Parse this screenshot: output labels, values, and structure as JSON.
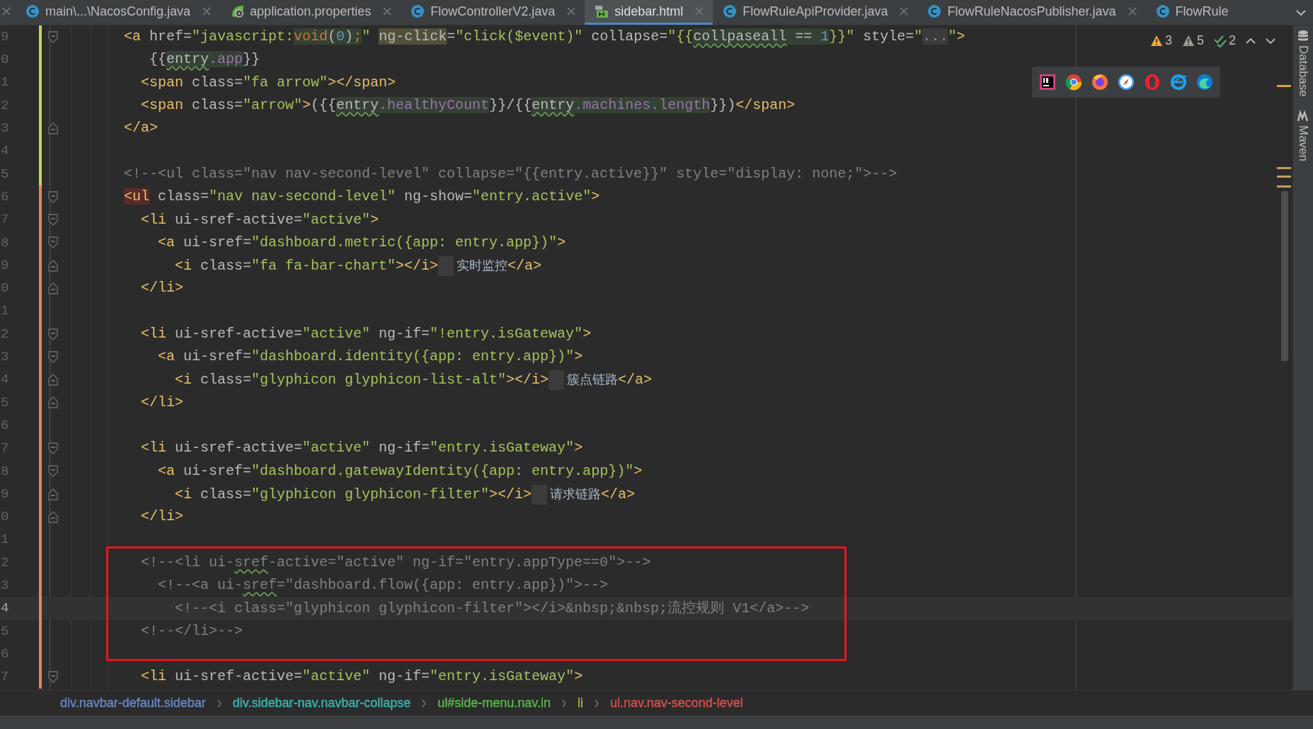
{
  "tabs": [
    {
      "title": "main\\...\\NacosConfig.java",
      "kind": "java",
      "selected": false,
      "closable": true
    },
    {
      "title": "application.properties",
      "kind": "properties",
      "selected": false,
      "closable": true
    },
    {
      "title": "FlowControllerV2.java",
      "kind": "java",
      "selected": false,
      "closable": true
    },
    {
      "title": "sidebar.html",
      "kind": "html",
      "selected": true,
      "closable": true
    },
    {
      "title": "FlowRuleApiProvider.java",
      "kind": "java",
      "selected": false,
      "closable": true
    },
    {
      "title": "FlowRuleNacosPublisher.java",
      "kind": "java",
      "selected": false,
      "closable": true
    },
    {
      "title": "FlowRule",
      "kind": "java",
      "selected": false,
      "closable": false
    }
  ],
  "inspections": [
    {
      "kind": "warning",
      "count": "3"
    },
    {
      "kind": "weak-warning",
      "count": "5"
    },
    {
      "kind": "typo",
      "count": "2"
    }
  ],
  "lines": [
    {
      "number": "9",
      "current": false,
      "color": "#c5d65a",
      "fold_start": true,
      "fold_end": false,
      "tokens": [
        {
          "kind": "tag",
          "text": "<a"
        },
        {
          "kind": "attr",
          "text": " href="
        },
        {
          "kind": "str",
          "text": "\"javascript:"
        },
        {
          "kind": "usage-keyword",
          "text": "void"
        },
        {
          "kind": "usage-text",
          "text": "("
        },
        {
          "kind": "usage-num",
          "text": "0"
        },
        {
          "kind": "usage-text",
          "text": ")"
        },
        {
          "kind": "usage-keyword",
          "text": ";"
        },
        {
          "kind": "str",
          "text": "\" "
        },
        {
          "kind": "match-attr",
          "text": "ng-click"
        },
        {
          "kind": "attr",
          "text": "="
        },
        {
          "kind": "str",
          "text": "\"click($event)\""
        },
        {
          "kind": "attr",
          "text": " collapse="
        },
        {
          "kind": "str",
          "text": "\"{{"
        },
        {
          "kind": "usage-ident",
          "text": "collpaseall"
        },
        {
          "kind": "usage-text",
          "text": " == "
        },
        {
          "kind": "usage-num",
          "text": "1"
        },
        {
          "kind": "str",
          "text": "}}\""
        },
        {
          "kind": "attr",
          "text": " style="
        },
        {
          "kind": "str",
          "text": "\""
        },
        {
          "kind": "folded-text",
          "text": "..."
        },
        {
          "kind": "str",
          "text": "\""
        },
        {
          "kind": "tag",
          "text": ">"
        }
      ]
    },
    {
      "number": "0",
      "current": false,
      "color": "#c5d65a",
      "fold_start": false,
      "fold_end": false,
      "tokens": [
        {
          "kind": "text",
          "text": "   {{"
        },
        {
          "kind": "usage-ident",
          "text": "entry"
        },
        {
          "kind": "usage-field",
          "text": ".app"
        },
        {
          "kind": "text",
          "text": "}}"
        }
      ]
    },
    {
      "number": "1",
      "current": false,
      "color": "#c5d65a",
      "fold_start": false,
      "fold_end": false,
      "tokens": [
        {
          "kind": "tag",
          "text": "  <span"
        },
        {
          "kind": "attr",
          "text": " class="
        },
        {
          "kind": "str",
          "text": "\"fa arrow\""
        },
        {
          "kind": "tag",
          "text": "></span>"
        }
      ]
    },
    {
      "number": "2",
      "current": false,
      "color": "#c5d65a",
      "fold_start": false,
      "fold_end": false,
      "tokens": [
        {
          "kind": "tag",
          "text": "  <span"
        },
        {
          "kind": "attr",
          "text": " class="
        },
        {
          "kind": "str",
          "text": "\"arrow\""
        },
        {
          "kind": "tag",
          "text": ">"
        },
        {
          "kind": "text",
          "text": "({{"
        },
        {
          "kind": "usage-ident",
          "text": "entry"
        },
        {
          "kind": "usage-field",
          "text": ".healthyCount"
        },
        {
          "kind": "text",
          "text": "}}/{{"
        },
        {
          "kind": "usage-ident",
          "text": "entry"
        },
        {
          "kind": "usage-field",
          "text": ".machines.length"
        },
        {
          "kind": "text",
          "text": "}})"
        },
        {
          "kind": "tag",
          "text": "</span>"
        }
      ]
    },
    {
      "number": "3",
      "current": false,
      "color": "#c5d65a",
      "fold_start": false,
      "fold_end": true,
      "tokens": [
        {
          "kind": "tag",
          "text": "</a>"
        }
      ]
    },
    {
      "number": "4",
      "current": false,
      "color": "#c5d65a",
      "fold_start": false,
      "fold_end": false
    },
    {
      "number": "5",
      "current": false,
      "color": "#c5d65a",
      "fold_start": false,
      "fold_end": false,
      "tokens": [
        {
          "kind": "comment",
          "text": "<!--<ul class=\"nav nav-second-level\" collapse=\"{{entry.active}}\" style=\"display: none;\">-->"
        }
      ]
    },
    {
      "number": "6",
      "current": false,
      "color": "#e8806c",
      "fold_start": true,
      "fold_end": false,
      "tokens": [
        {
          "kind": "error-tag",
          "text": "<ul"
        },
        {
          "kind": "attr",
          "text": " class="
        },
        {
          "kind": "str",
          "text": "\"nav nav-second-level\""
        },
        {
          "kind": "attr",
          "text": " ng-show="
        },
        {
          "kind": "str",
          "text": "\"entry.active\""
        },
        {
          "kind": "tag",
          "text": ">"
        }
      ]
    },
    {
      "number": "7",
      "current": false,
      "color": "#e8806c",
      "fold_start": true,
      "fold_end": false,
      "tokens": [
        {
          "kind": "tag",
          "text": "  <li"
        },
        {
          "kind": "attr",
          "text": " ui-sref-active="
        },
        {
          "kind": "str",
          "text": "\"active\""
        },
        {
          "kind": "tag",
          "text": ">"
        }
      ]
    },
    {
      "number": "8",
      "current": false,
      "color": "#e8806c",
      "fold_start": true,
      "fold_end": false,
      "tokens": [
        {
          "kind": "tag",
          "text": "    <a"
        },
        {
          "kind": "attr",
          "text": " ui-sref="
        },
        {
          "kind": "str",
          "text": "\"dashboard.metric({app: entry.app})\""
        },
        {
          "kind": "tag",
          "text": ">"
        }
      ]
    },
    {
      "number": "9",
      "current": false,
      "color": "#e8806c",
      "fold_start": false,
      "fold_end": true,
      "tokens": [
        {
          "kind": "tag",
          "text": "      <i"
        },
        {
          "kind": "attr",
          "text": " class="
        },
        {
          "kind": "str",
          "text": "\"fa fa-bar-chart\""
        },
        {
          "kind": "tag",
          "text": "></i>"
        },
        {
          "kind": "cjk",
          "text": "实时监控"
        },
        {
          "kind": "tag",
          "text": "</a>"
        }
      ]
    },
    {
      "number": "0",
      "current": false,
      "color": "#e8806c",
      "fold_start": false,
      "fold_end": true,
      "tokens": [
        {
          "kind": "tag",
          "text": "  </li>"
        }
      ]
    },
    {
      "number": "1",
      "current": false,
      "color": "#e8806c",
      "fold_start": false,
      "fold_end": false
    },
    {
      "number": "2",
      "current": false,
      "color": "#e8806c",
      "fold_start": true,
      "fold_end": false,
      "tokens": [
        {
          "kind": "tag",
          "text": "  <li"
        },
        {
          "kind": "attr",
          "text": " ui-sref-active="
        },
        {
          "kind": "str",
          "text": "\"active\""
        },
        {
          "kind": "attr",
          "text": " ng-if="
        },
        {
          "kind": "str",
          "text": "\"!entry.isGateway\""
        },
        {
          "kind": "tag",
          "text": ">"
        }
      ]
    },
    {
      "number": "3",
      "current": false,
      "color": "#e8806c",
      "fold_start": true,
      "fold_end": false,
      "tokens": [
        {
          "kind": "tag",
          "text": "    <a"
        },
        {
          "kind": "attr",
          "text": " ui-sref="
        },
        {
          "kind": "str",
          "text": "\"dashboard.identity({app: entry.app})\""
        },
        {
          "kind": "tag",
          "text": ">"
        }
      ]
    },
    {
      "number": "4",
      "current": false,
      "color": "#e8806c",
      "fold_start": false,
      "fold_end": true,
      "tokens": [
        {
          "kind": "tag",
          "text": "      <i"
        },
        {
          "kind": "attr",
          "text": " class="
        },
        {
          "kind": "str",
          "text": "\"glyphicon glyphicon-list-alt\""
        },
        {
          "kind": "tag",
          "text": "></i>"
        },
        {
          "kind": "cjk",
          "text": "簇点链路"
        },
        {
          "kind": "tag",
          "text": "</a>"
        }
      ]
    },
    {
      "number": "5",
      "current": false,
      "color": "#e8806c",
      "fold_start": false,
      "fold_end": true,
      "tokens": [
        {
          "kind": "tag",
          "text": "  </li>"
        }
      ]
    },
    {
      "number": "6",
      "current": false,
      "color": "#e8806c",
      "fold_start": false,
      "fold_end": false
    },
    {
      "number": "7",
      "current": false,
      "color": "#e8806c",
      "fold_start": true,
      "fold_end": false,
      "tokens": [
        {
          "kind": "tag",
          "text": "  <li"
        },
        {
          "kind": "attr",
          "text": " ui-sref-active="
        },
        {
          "kind": "str",
          "text": "\"active\""
        },
        {
          "kind": "attr",
          "text": " ng-if="
        },
        {
          "kind": "str",
          "text": "\"entry.isGateway\""
        },
        {
          "kind": "tag",
          "text": ">"
        }
      ]
    },
    {
      "number": "8",
      "current": false,
      "color": "#e8806c",
      "fold_start": true,
      "fold_end": false,
      "tokens": [
        {
          "kind": "tag",
          "text": "    <a"
        },
        {
          "kind": "attr",
          "text": " ui-sref="
        },
        {
          "kind": "str",
          "text": "\"dashboard.gatewayIdentity({app: entry.app})\""
        },
        {
          "kind": "tag",
          "text": ">"
        }
      ]
    },
    {
      "number": "9",
      "current": false,
      "color": "#e8806c",
      "fold_start": false,
      "fold_end": true,
      "tokens": [
        {
          "kind": "tag",
          "text": "      <i"
        },
        {
          "kind": "attr",
          "text": " class="
        },
        {
          "kind": "str",
          "text": "\"glyphicon glyphicon-filter\""
        },
        {
          "kind": "tag",
          "text": "></i>"
        },
        {
          "kind": "cjk",
          "text": "请求链路"
        },
        {
          "kind": "tag",
          "text": "</a>"
        }
      ]
    },
    {
      "number": "0",
      "current": false,
      "color": "#e8806c",
      "fold_start": false,
      "fold_end": true,
      "tokens": [
        {
          "kind": "tag",
          "text": "  </li>"
        }
      ]
    },
    {
      "number": "1",
      "current": false,
      "color": "#e8806c",
      "fold_start": false,
      "fold_end": false
    },
    {
      "number": "2",
      "current": false,
      "color": "#e8806c",
      "fold_start": false,
      "fold_end": false,
      "tokens": [
        {
          "kind": "comment",
          "text": "  <!--<li ui-"
        },
        {
          "kind": "comment-typo",
          "text": "sref"
        },
        {
          "kind": "comment",
          "text": "-active=\"active\" ng-if=\"entry.appType==0\">-->"
        }
      ]
    },
    {
      "number": "3",
      "current": false,
      "color": "#e8806c",
      "fold_start": false,
      "fold_end": false,
      "tokens": [
        {
          "kind": "comment",
          "text": "    <!--<a ui-"
        },
        {
          "kind": "comment-typo",
          "text": "sref"
        },
        {
          "kind": "comment",
          "text": "=\"dashboard.flow({app: entry.app})\">-->"
        }
      ]
    },
    {
      "number": "4",
      "current": true,
      "color": "#e8806c",
      "fold_start": false,
      "fold_end": false,
      "tokens": [
        {
          "kind": "comment",
          "text": "      <!--<i class=\"glyphicon glyphicon-filter\"></i>&nbsp;&nbsp;流控规则 V1</a>-->"
        }
      ]
    },
    {
      "number": "5",
      "current": false,
      "color": "#e8806c",
      "fold_start": false,
      "fold_end": false,
      "tokens": [
        {
          "kind": "comment",
          "text": "  <!--</li>-->"
        }
      ]
    },
    {
      "number": "6",
      "current": false,
      "color": "#e8806c",
      "fold_start": false,
      "fold_end": false
    },
    {
      "number": "7",
      "current": false,
      "color": "#e8806c",
      "fold_start": true,
      "fold_end": false,
      "tokens": [
        {
          "kind": "tag",
          "text": "  <li"
        },
        {
          "kind": "attr",
          "text": " ui-sref-active="
        },
        {
          "kind": "str",
          "text": "\"active\""
        },
        {
          "kind": "attr",
          "text": " ng-if="
        },
        {
          "kind": "str",
          "text": "\"entry.isGateway\""
        },
        {
          "kind": "tag",
          "text": ">"
        }
      ]
    }
  ],
  "tool_windows": [
    {
      "kind": "database",
      "label": "Database"
    },
    {
      "kind": "maven",
      "label": "Maven"
    }
  ],
  "breadcrumbs": [
    {
      "text": "div.navbar-default.sidebar",
      "color": "#6a87c4"
    },
    {
      "text": "div.sidebar-nav.navbar-collapse",
      "color": "#3fb3ad"
    },
    {
      "text": "ul#side-menu.nav.in",
      "color": "#5bb84b"
    },
    {
      "text": "li",
      "color": "#b6b33a"
    },
    {
      "text": "ul.nav.nav-second-level",
      "color": "#d4524f"
    }
  ]
}
